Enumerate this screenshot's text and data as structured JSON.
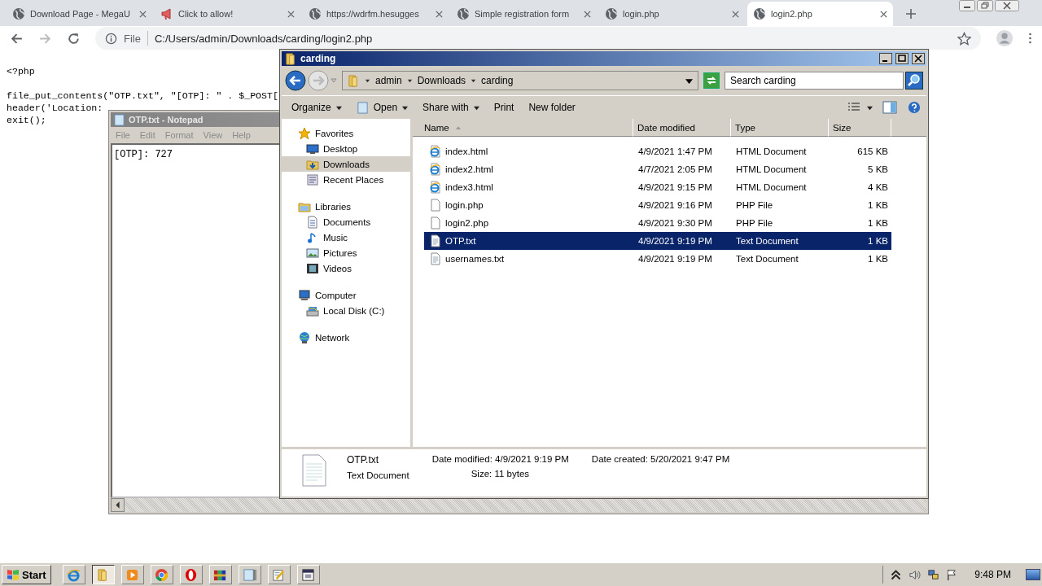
{
  "browser": {
    "tabs": [
      {
        "title": "Download Page - MegaU",
        "kind": "globe",
        "selected": false
      },
      {
        "title": "Click to allow!",
        "kind": "megaphone",
        "selected": false
      },
      {
        "title": "https://wdrfm.hesugges",
        "kind": "globe",
        "selected": false
      },
      {
        "title": "Simple registration form",
        "kind": "globe",
        "selected": false
      },
      {
        "title": "login.php",
        "kind": "globe",
        "selected": false
      },
      {
        "title": "login2.php",
        "kind": "globe",
        "selected": true
      }
    ],
    "address": {
      "scheme": "File",
      "url": "C:/Users/admin/Downloads/carding/login2.php"
    },
    "code_blocks": [
      [
        "<?php"
      ],
      [
        "file_put_contents(\"OTP.txt\", \"[OTP]: \" . $_POST[",
        "header('Location: ",
        "exit();"
      ]
    ]
  },
  "notepad": {
    "title": "OTP.txt - Notepad",
    "menu": [
      "File",
      "Edit",
      "Format",
      "View",
      "Help"
    ],
    "text": "[OTP]: 727"
  },
  "explorer": {
    "title": "carding",
    "breadcrumb": [
      "admin",
      "Downloads",
      "carding"
    ],
    "search": {
      "placeholder": "Search carding"
    },
    "toolbar": [
      {
        "label": "Organize",
        "kind": "menu"
      },
      {
        "label": "Open",
        "kind": "open"
      },
      {
        "label": "Share with",
        "kind": "menu"
      },
      {
        "label": "Print",
        "kind": "plain"
      },
      {
        "label": "New folder",
        "kind": "plain"
      }
    ],
    "nav": [
      {
        "label": "Favorites",
        "kind": "star",
        "children": [
          {
            "label": "Desktop",
            "kind": "desktop",
            "selected": false
          },
          {
            "label": "Downloads",
            "kind": "downloads",
            "selected": true
          },
          {
            "label": "Recent Places",
            "kind": "recent",
            "selected": false
          }
        ]
      },
      {
        "label": "Libraries",
        "kind": "libraries",
        "children": [
          {
            "label": "Documents",
            "kind": "documents",
            "selected": false
          },
          {
            "label": "Music",
            "kind": "music",
            "selected": false
          },
          {
            "label": "Pictures",
            "kind": "pictures",
            "selected": false
          },
          {
            "label": "Videos",
            "kind": "videos",
            "selected": false
          }
        ]
      },
      {
        "label": "Computer",
        "kind": "computer",
        "children": [
          {
            "label": "Local Disk (C:)",
            "kind": "disk",
            "selected": false
          }
        ]
      },
      {
        "label": "Network",
        "kind": "network"
      }
    ],
    "columns": [
      {
        "label": "Name",
        "sorted": true
      },
      {
        "label": "Date modified",
        "sorted": false
      },
      {
        "label": "Type",
        "sorted": false
      },
      {
        "label": "Size",
        "sorted": false
      }
    ],
    "rows": [
      {
        "name": "index.html",
        "date": "4/9/2021 1:47 PM",
        "type": "HTML Document",
        "size": "615 KB",
        "kind": "html",
        "selected": false
      },
      {
        "name": "index2.html",
        "date": "4/7/2021 2:05 PM",
        "type": "HTML Document",
        "size": "5 KB",
        "kind": "html",
        "selected": false
      },
      {
        "name": "index3.html",
        "date": "4/9/2021 9:15 PM",
        "type": "HTML Document",
        "size": "4 KB",
        "kind": "html",
        "selected": false
      },
      {
        "name": "login.php",
        "date": "4/9/2021 9:16 PM",
        "type": "PHP File",
        "size": "1 KB",
        "kind": "file",
        "selected": false
      },
      {
        "name": "login2.php",
        "date": "4/9/2021 9:30 PM",
        "type": "PHP File",
        "size": "1 KB",
        "kind": "file",
        "selected": false
      },
      {
        "name": "OTP.txt",
        "date": "4/9/2021 9:19 PM",
        "type": "Text Document",
        "size": "1 KB",
        "kind": "text",
        "selected": true
      },
      {
        "name": "usernames.txt",
        "date": "4/9/2021 9:19 PM",
        "type": "Text Document",
        "size": "1 KB",
        "kind": "text",
        "selected": false
      }
    ],
    "details": {
      "name": "OTP.txt",
      "type": "Text Document",
      "modified": "Date modified: 4/9/2021 9:19 PM",
      "size": "Size: 11 bytes",
      "created": "Date created: 5/20/2021 9:47 PM"
    }
  },
  "taskbar": {
    "start": "Start",
    "apps": [
      {
        "kind": "ie",
        "active": false
      },
      {
        "kind": "folder",
        "active": true
      },
      {
        "kind": "media",
        "active": false
      },
      {
        "kind": "chrome",
        "active": false
      },
      {
        "kind": "opera",
        "active": false
      },
      {
        "kind": "archive",
        "active": false
      },
      {
        "kind": "notepad",
        "active": false
      },
      {
        "kind": "editor",
        "active": false
      },
      {
        "kind": "window",
        "active": false
      }
    ],
    "clock": "9:48 PM"
  }
}
